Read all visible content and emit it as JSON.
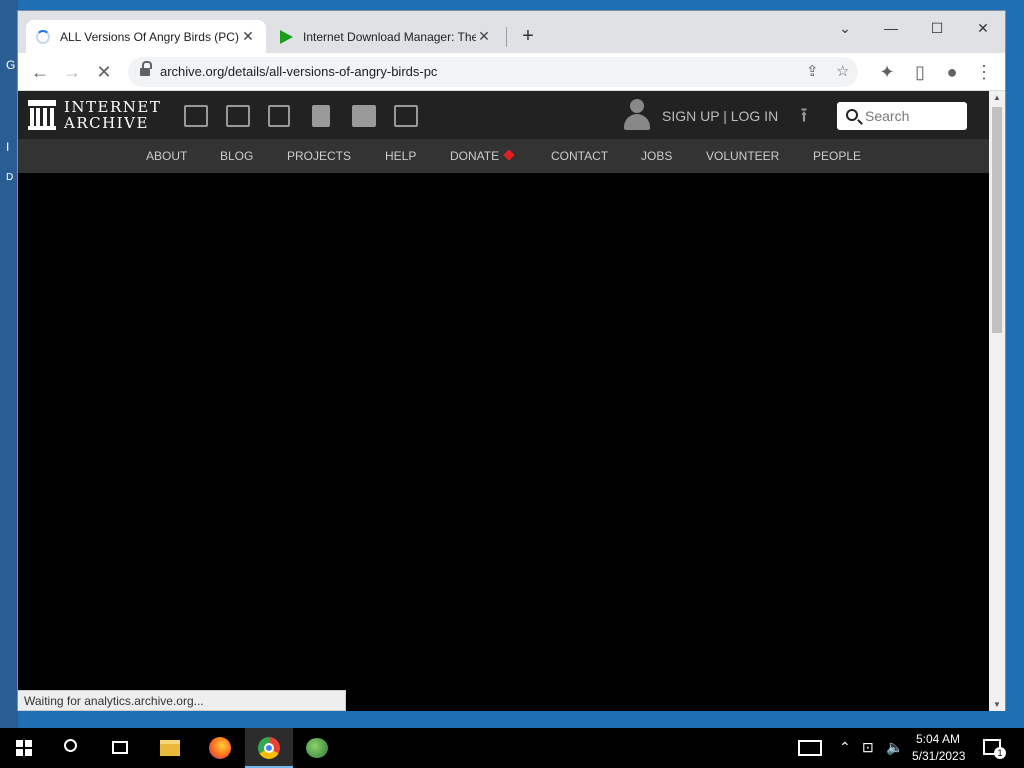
{
  "desktop": {
    "glyphs": [
      "G",
      "I",
      "D"
    ]
  },
  "browser": {
    "tabs": [
      {
        "title": "ALL Versions Of Angry Birds (PC)",
        "icon": "loading-spinner",
        "active": true
      },
      {
        "title": "Internet Download Manager: The",
        "icon": "idm-play-icon",
        "active": false
      }
    ],
    "new_tab_label": "+",
    "window_controls": {
      "dropdown": "⌄",
      "minimize": "—",
      "maximize": "☐",
      "close": "✕"
    },
    "toolbar": {
      "url": "archive.org/details/all-versions-of-angry-birds-pc",
      "back": "←",
      "forward": "→",
      "stop": "✕"
    },
    "status_text": "Waiting for analytics.archive.org..."
  },
  "archive": {
    "logo_line1": "INTERNET",
    "logo_line2": "ARCHIVE",
    "media_icons": [
      "web-icon",
      "texts-icon",
      "video-icon",
      "audio-icon",
      "software-icon",
      "images-icon"
    ],
    "auth_label": "SIGN UP | LOG IN",
    "search_placeholder": "Search",
    "nav": [
      "ABOUT",
      "BLOG",
      "PROJECTS",
      "HELP",
      "DONATE",
      "CONTACT",
      "JOBS",
      "VOLUNTEER",
      "PEOPLE"
    ]
  },
  "taskbar": {
    "apps": [
      "start",
      "search",
      "task-view",
      "file-explorer",
      "firefox",
      "chrome",
      "idm"
    ],
    "time": "5:04 AM",
    "date": "5/31/2023",
    "notification_count": "1"
  },
  "colors": {
    "page_bg": "#000000",
    "ia_header": "#222222",
    "ia_nav": "#333333",
    "donate_heart": "#e02020",
    "taskbar": "#000000"
  }
}
